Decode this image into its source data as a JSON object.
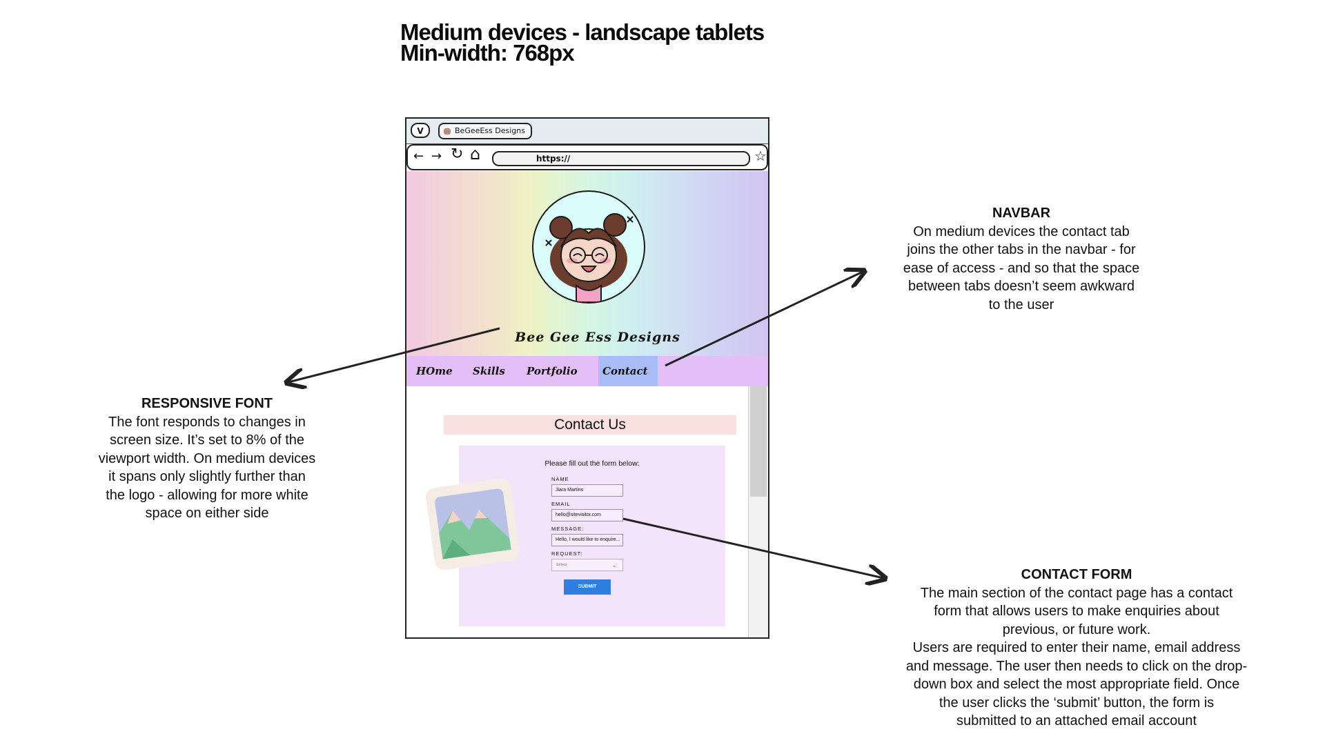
{
  "title": {
    "line1": "Medium devices - landscape tablets",
    "line2": "Min-width: 768px"
  },
  "annotations": {
    "navbar": {
      "heading": "NAVBAR",
      "lines": [
        "On medium devices the contact tab",
        "joins the other tabs in the navbar - for",
        "ease of access - and so that the space",
        "between tabs doesn’t seem awkward",
        "to the user"
      ]
    },
    "responsive_font": {
      "heading": "RESPONSIVE FONT",
      "lines": [
        "The font responds to changes in",
        "screen size. It’s set to 8% of the",
        "viewport width. On medium devices",
        "it spans only slightly further than",
        "the logo - allowing for more white",
        "space on either side"
      ]
    },
    "contact_form": {
      "heading": "CONTACT FORM",
      "lines": [
        "The main section of the contact page has a contact",
        "form that allows users to make enquiries about",
        "previous, or future work.",
        "Users are required  to enter their name, email address",
        "and message. The user then needs to click on the drop-",
        "down box and select the most appropriate field. Once",
        "the user clicks the ‘submit’ button, the form is",
        "submitted to an attached email account"
      ]
    }
  },
  "browser": {
    "menu_label": "V",
    "tab_title": "BeGeeEss Designs",
    "back_icon": "←",
    "forward_icon": "→",
    "reload_icon": "↻",
    "home_icon": "⌂",
    "url": "https://",
    "bookmark_icon": "☆"
  },
  "site": {
    "brand": "Bee Gee Ess Designs",
    "nav": [
      "HOme",
      "Skills",
      "Portfolio",
      "Contact"
    ],
    "active_nav": "Contact",
    "colors": {
      "navbar": "#e4bff7",
      "active_tab": "#a9bcf7",
      "heading_bg": "#fbe0e0",
      "form_bg": "#f4e4fb",
      "submit": "#2f7fe0"
    },
    "contact": {
      "heading": "Contact Us",
      "intro": "Please fill out the form below:",
      "name_label": "NAME",
      "name_value": "Jiara Martins",
      "email_label": "EMAIL",
      "email_value": "hello@sitevisitor.com",
      "message_label": "MESSAGE:",
      "message_value": "Hello, I would like to enquire...",
      "request_label": "REQUEST:",
      "request_value": "Select",
      "submit_label": "SUBMIT"
    }
  }
}
